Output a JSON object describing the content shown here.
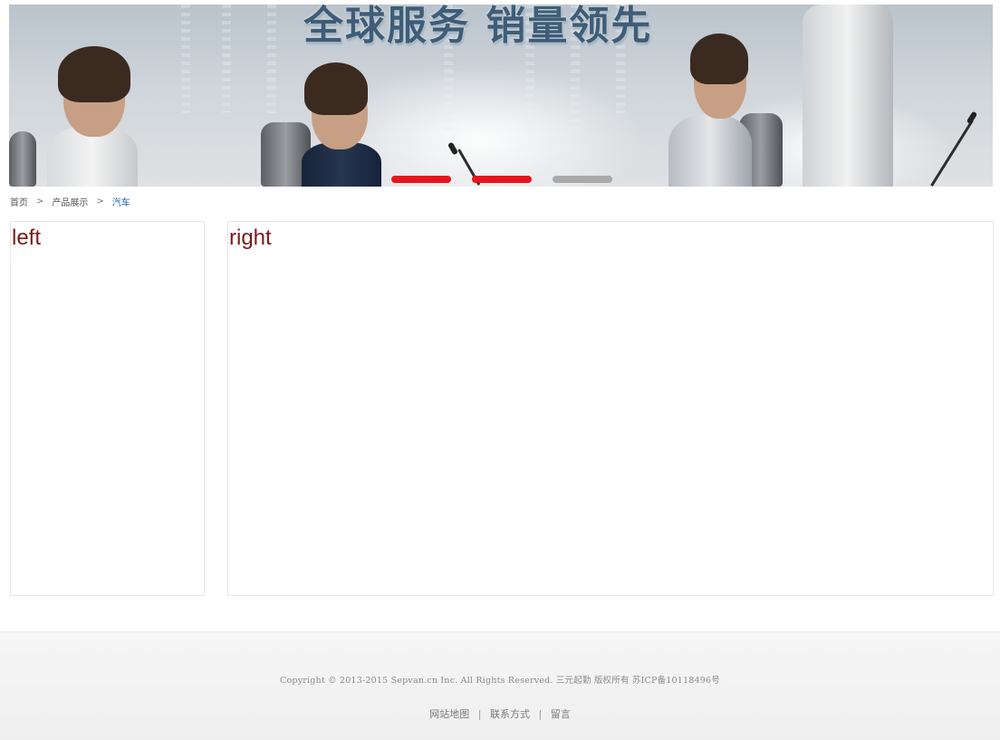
{
  "banner": {
    "slogan": "全球服务  销量领先",
    "slider": {
      "count": 3,
      "active_color": "#e8141d",
      "inactive_color": "#a9a9a9",
      "states": [
        "active",
        "active",
        "inactive"
      ]
    }
  },
  "breadcrumb": {
    "items": [
      "首页",
      "产品展示",
      "汽车"
    ],
    "separator": ">"
  },
  "left_panel": {
    "title": "left"
  },
  "right_panel": {
    "title": "right"
  },
  "footer": {
    "copyright": "Copyright © 2013-2015 Sepvan.cn Inc. All Rights Reserved. 三元起勤 版权所有 苏ICP备10118496号",
    "links": [
      "网站地图",
      "联系方式",
      "留言"
    ],
    "link_separator": "|"
  },
  "colors": {
    "panel_title": "#7b1a1a",
    "breadcrumb_current": "#1e5fa8",
    "footer_text": "#8a8a8a"
  }
}
